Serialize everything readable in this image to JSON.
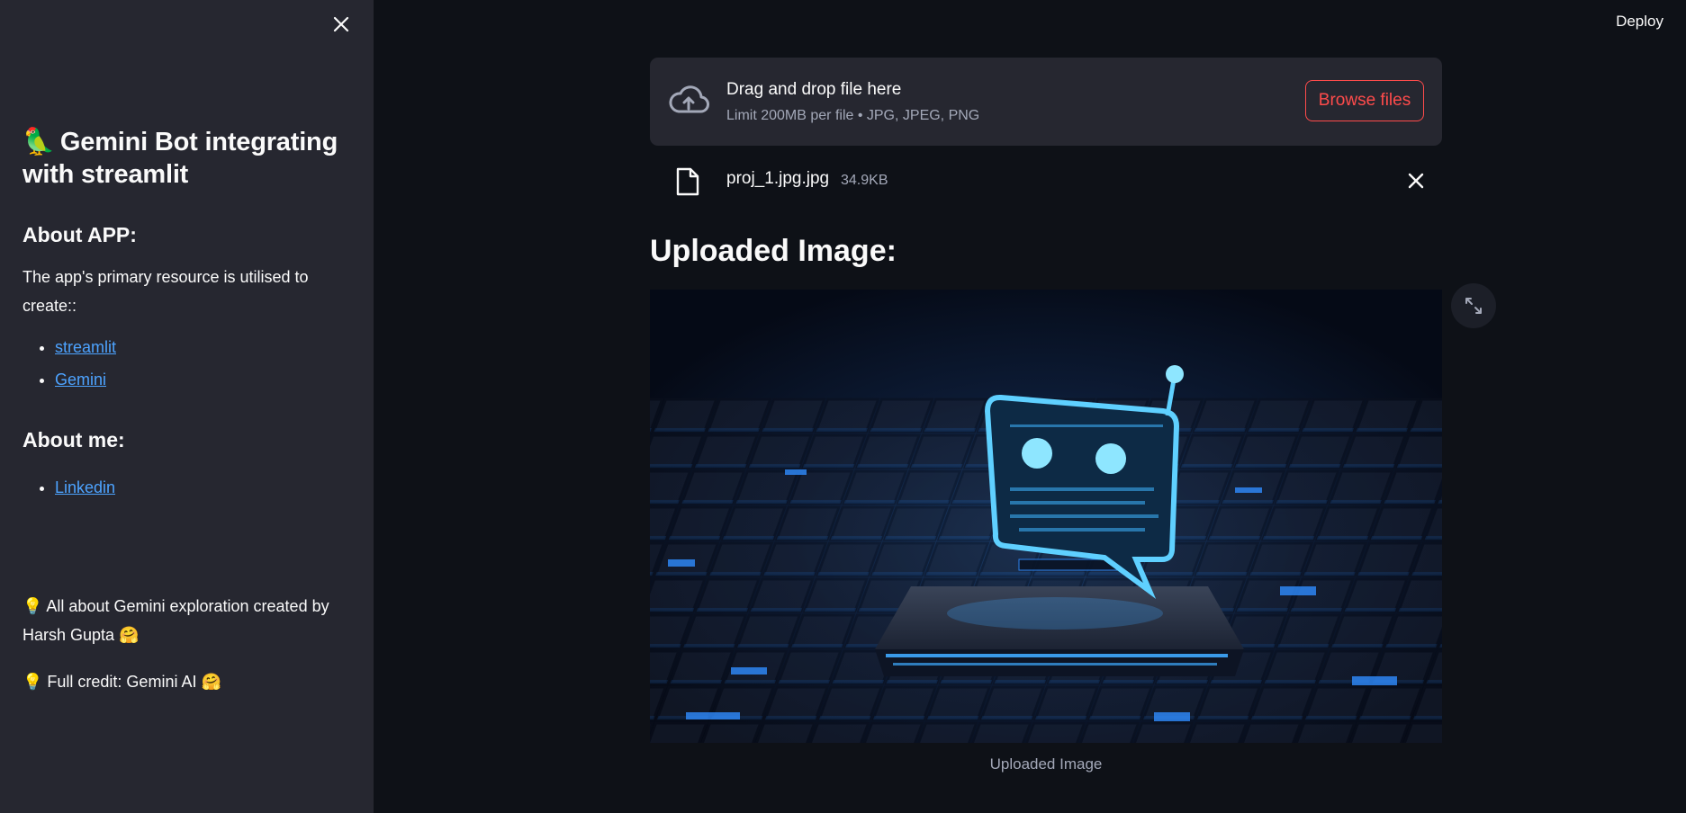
{
  "header": {
    "deploy_label": "Deploy"
  },
  "sidebar": {
    "title_emoji": "🦜",
    "title": "Gemini Bot integrating with streamlit",
    "about_app_heading": "About APP:",
    "about_app_text": "The app's primary resource is utilised to create::",
    "links": [
      {
        "label": "streamlit"
      },
      {
        "label": "Gemini"
      }
    ],
    "about_me_heading": "About me:",
    "about_me_links": [
      {
        "label": "Linkedin"
      }
    ],
    "credit_1": "💡 All about Gemini exploration created by Harsh Gupta 🤗",
    "credit_2": "💡 Full credit: Gemini AI 🤗"
  },
  "uploader": {
    "title": "Drag and drop file here",
    "subtitle": "Limit 200MB per file • JPG, JPEG, PNG",
    "browse_label": "Browse files",
    "file_name": "proj_1.jpg.jpg",
    "file_size": "34.9KB"
  },
  "main": {
    "heading": "Uploaded Image:",
    "caption": "Uploaded Image"
  },
  "colors": {
    "accent": "#ff4b4b",
    "link": "#4da3ff",
    "sidebar_bg": "#262730",
    "main_bg": "#0e1117"
  }
}
